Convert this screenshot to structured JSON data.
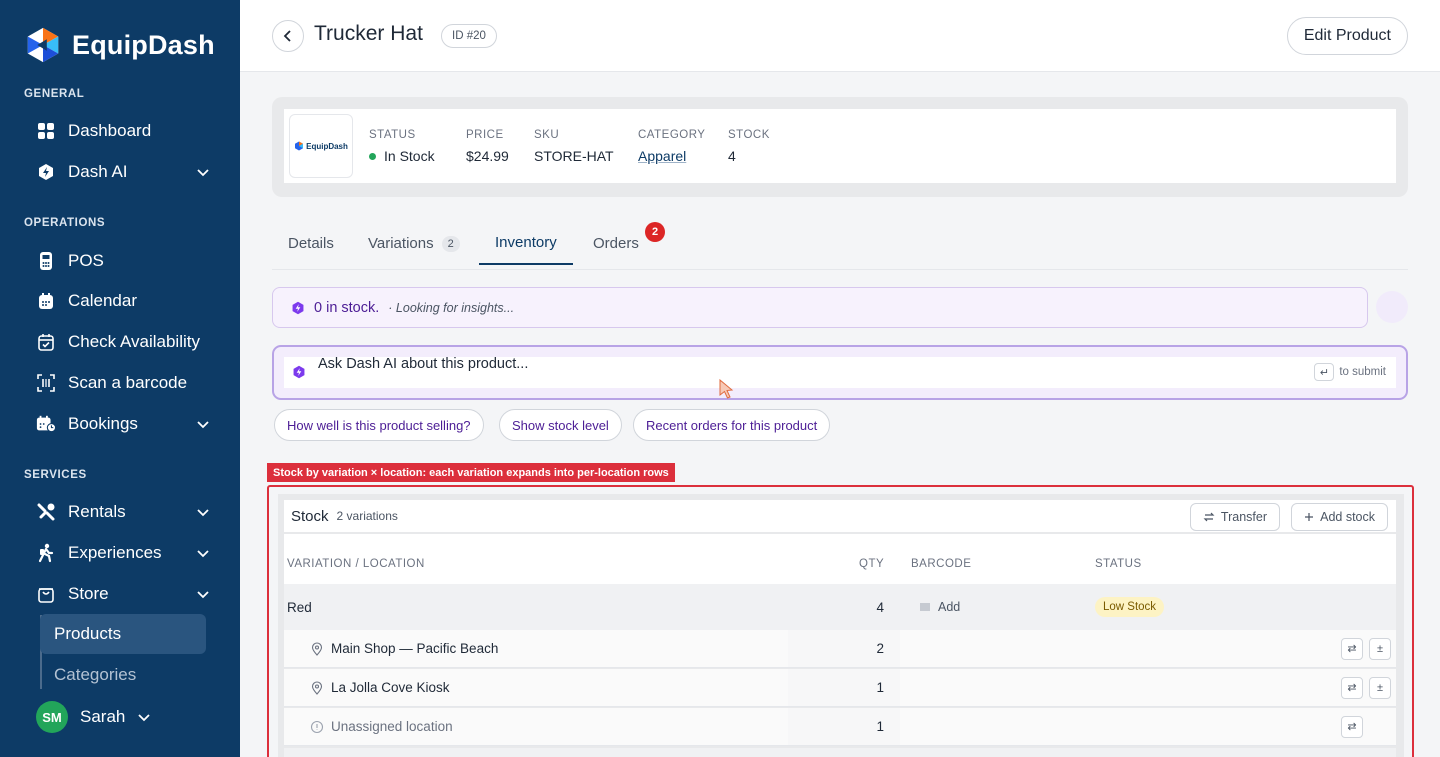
{
  "app": {
    "name": "EquipDash"
  },
  "sidebar": {
    "sections": {
      "general": "GENERAL",
      "operations": "OPERATIONS",
      "services": "SERVICES"
    },
    "items": {
      "dashboard": "Dashboard",
      "dash_ai": "Dash AI",
      "pos": "POS",
      "calendar": "Calendar",
      "check_availability": "Check Availability",
      "scan_barcode": "Scan a barcode",
      "bookings": "Bookings",
      "rentals": "Rentals",
      "experiences": "Experiences",
      "store": "Store"
    },
    "store_sub": {
      "products": "Products",
      "categories": "Categories"
    },
    "user": {
      "initials": "SM",
      "name": "Sarah"
    }
  },
  "header": {
    "title": "Trucker Hat",
    "id_badge": "ID #20",
    "edit_label": "Edit Product"
  },
  "summary": {
    "thumb_label": "EquipDash",
    "status": {
      "label": "STATUS",
      "value": "In Stock"
    },
    "price": {
      "label": "PRICE",
      "value": "$24.99"
    },
    "sku": {
      "label": "SKU",
      "value": "STORE-HAT"
    },
    "category": {
      "label": "CATEGORY",
      "value": "Apparel"
    },
    "stock": {
      "label": "STOCK",
      "value": "4"
    }
  },
  "tabs": {
    "details": "Details",
    "variations": "Variations",
    "variations_count": "2",
    "inventory": "Inventory",
    "orders": "Orders",
    "orders_badge": "2"
  },
  "insight": {
    "main": "0 in stock.",
    "sub": "· Looking for insights..."
  },
  "ask": {
    "text": "Ask Dash AI about this product...",
    "submit_hint": "to submit",
    "enter_key": "↵"
  },
  "suggestions": {
    "s1": "How well is this product selling?",
    "s2": "Show stock level",
    "s3": "Recent orders for this product"
  },
  "annotation": {
    "label": "Stock by variation × location: each variation expands into per-location rows"
  },
  "stock": {
    "title": "Stock",
    "subtitle": "2 variations",
    "transfer_label": "Transfer",
    "add_stock_label": "Add stock",
    "columns": {
      "variation": "VARIATION / LOCATION",
      "qty": "QTY",
      "barcode": "BARCODE",
      "status": "STATUS"
    },
    "group": {
      "name": "Red",
      "qty": "4",
      "barcode_add": "Add",
      "status": "Low Stock"
    },
    "locations": [
      {
        "name": "Main Shop — Pacific Beach",
        "qty": "2"
      },
      {
        "name": "La Jolla Cove Kiosk",
        "qty": "1"
      },
      {
        "name": "Unassigned location",
        "qty": "1"
      }
    ]
  },
  "colors": {
    "sidebar": "#0d3b66",
    "accent_purple": "#4c1d95",
    "danger": "#dc2626",
    "success": "#22a55a"
  }
}
